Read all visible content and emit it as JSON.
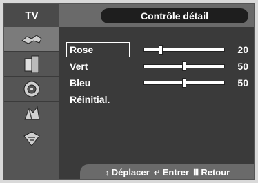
{
  "header": {
    "tv_label": "TV",
    "title": "Contrôle détail"
  },
  "sidebar": {
    "items": [
      {
        "icon": "picture-icon",
        "active": true
      },
      {
        "icon": "sound-icon",
        "active": false
      },
      {
        "icon": "speaker-icon",
        "active": false
      },
      {
        "icon": "setup-icon",
        "active": false
      },
      {
        "icon": "input-icon",
        "active": false
      }
    ]
  },
  "settings": [
    {
      "label": "Rose",
      "value": "20",
      "level": 20,
      "selected": true
    },
    {
      "label": "Vert",
      "value": "50",
      "level": 50,
      "selected": false
    },
    {
      "label": "Bleu",
      "value": "50",
      "level": 50,
      "selected": false
    },
    {
      "label": "Réinitial.",
      "value": "",
      "level": null,
      "selected": false
    }
  ],
  "footer": {
    "move_icon": "↕",
    "move_label": "Déplacer",
    "enter_icon": "↵",
    "enter_label": "Entrer",
    "return_icon": "Ⅲ",
    "return_label": "Retour"
  },
  "colors": {
    "background": "#3a3a3a",
    "header": "#6a6a6a",
    "title_box": "#1e1e1e",
    "text": "#ffffff"
  }
}
